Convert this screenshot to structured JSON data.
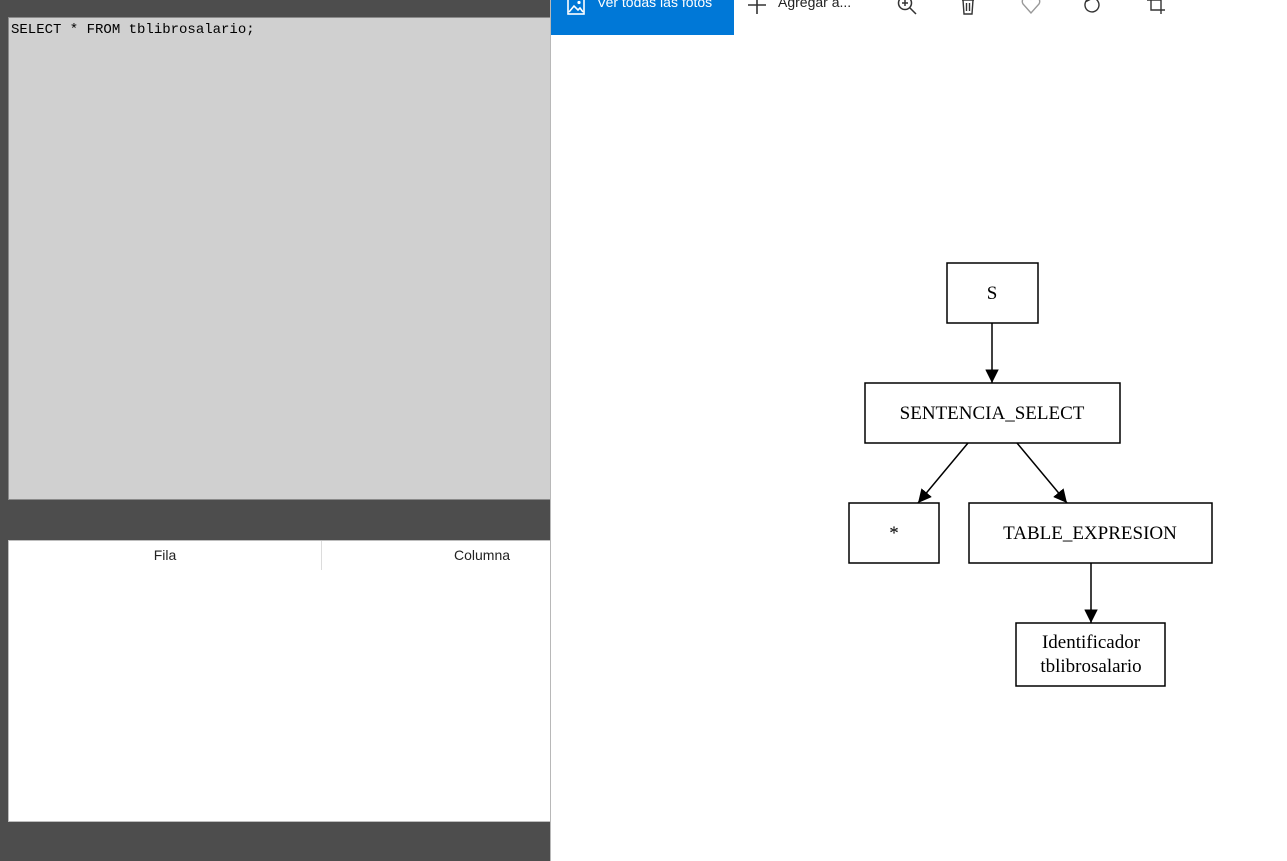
{
  "editor": {
    "query_text": "SELECT * FROM tblibrosalario;"
  },
  "errors_table": {
    "headers": [
      "Fila",
      "Columna"
    ]
  },
  "viewer": {
    "toolbar": {
      "view_all_label": "Ver todas las fotos",
      "add_label": "Agregar a...",
      "icons": [
        "image-icon",
        "plus-icon",
        "zoom-in-icon",
        "delete-icon",
        "heart-icon",
        "rotate-icon",
        "crop-icon"
      ]
    },
    "accent_color": "#0078d7"
  },
  "diagram": {
    "nodes": [
      {
        "id": "s",
        "label": "S"
      },
      {
        "id": "sentencia",
        "label": "SENTENCIA_SELECT"
      },
      {
        "id": "star",
        "label": "*"
      },
      {
        "id": "table",
        "label": "TABLE_EXPRESION"
      },
      {
        "id": "ident",
        "label_lines": [
          "Identificador",
          "tblibrosalario"
        ]
      }
    ],
    "edges": [
      [
        "s",
        "sentencia"
      ],
      [
        "sentencia",
        "star"
      ],
      [
        "sentencia",
        "table"
      ],
      [
        "table",
        "ident"
      ]
    ]
  }
}
